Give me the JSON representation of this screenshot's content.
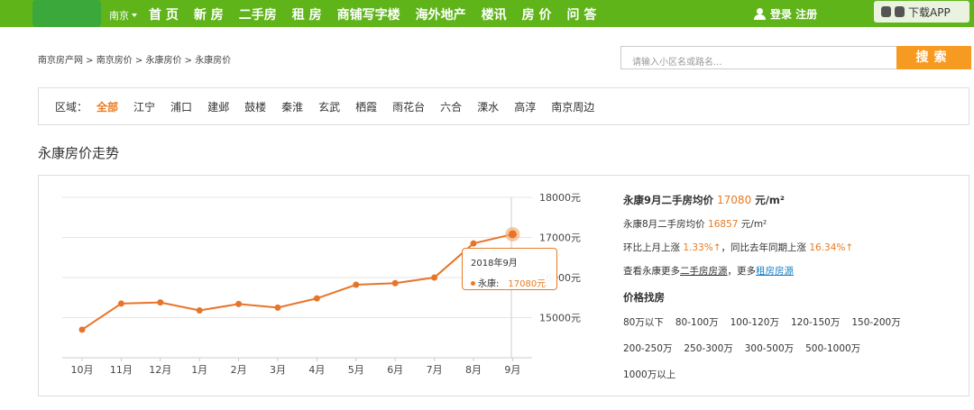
{
  "nav": {
    "city": "南京",
    "menu": [
      "首 页",
      "新 房",
      "二手房",
      "租 房",
      "商铺写字楼",
      "海外地产",
      "楼讯",
      "房 价",
      "问 答"
    ],
    "login": "登录 注册",
    "app": "下载APP"
  },
  "breadcrumb": "南京房产网 > 南京房价 > 永康房价 > 永康房价",
  "search": {
    "placeholder": "请输入小区名或路名...",
    "button": "搜索"
  },
  "filter": {
    "label": "区域：",
    "items": [
      "全部",
      "江宁",
      "浦口",
      "建邺",
      "鼓楼",
      "秦淮",
      "玄武",
      "栖霞",
      "雨花台",
      "六合",
      "溧水",
      "高淳",
      "南京周边"
    ],
    "selected": 0
  },
  "section_title": "永康房价走势",
  "chart_data": {
    "type": "line",
    "categories": [
      "10月",
      "11月",
      "12月",
      "1月",
      "2月",
      "3月",
      "4月",
      "5月",
      "6月",
      "7月",
      "8月",
      "9月"
    ],
    "series": [
      {
        "name": "永康",
        "values": [
          14700,
          15350,
          15380,
          15180,
          15340,
          15250,
          15480,
          15820,
          15860,
          16000,
          16850,
          17080
        ]
      }
    ],
    "yticks": [
      "18000元",
      "17000元",
      "16000元",
      "15000元"
    ],
    "ylim": [
      14000,
      18000
    ],
    "tooltip": {
      "title": "2018年9月",
      "name": "永康:",
      "value": "17080元"
    }
  },
  "info": {
    "title": "永康9月二手房均价",
    "title_value": "17080",
    "title_unit": "元/m²",
    "prev_label": "永康8月二手房均价",
    "prev_value": "16857",
    "prev_unit": "元/m²",
    "mom_label": "环比上月上涨",
    "mom_value": "1.33%↑",
    "yoy_label": "，同比去年同期上涨",
    "yoy_value": "16.34%↑",
    "more_prefix": "查看永康更多",
    "more_link1": "二手房房源",
    "more_mid": "，更多",
    "more_link2": "租房房源",
    "price_title": "价格找房",
    "prices": [
      "80万以下",
      "80-100万",
      "100-120万",
      "120-150万",
      "150-200万",
      "200-250万",
      "250-300万",
      "300-500万",
      "500-1000万",
      "1000万以上"
    ]
  }
}
